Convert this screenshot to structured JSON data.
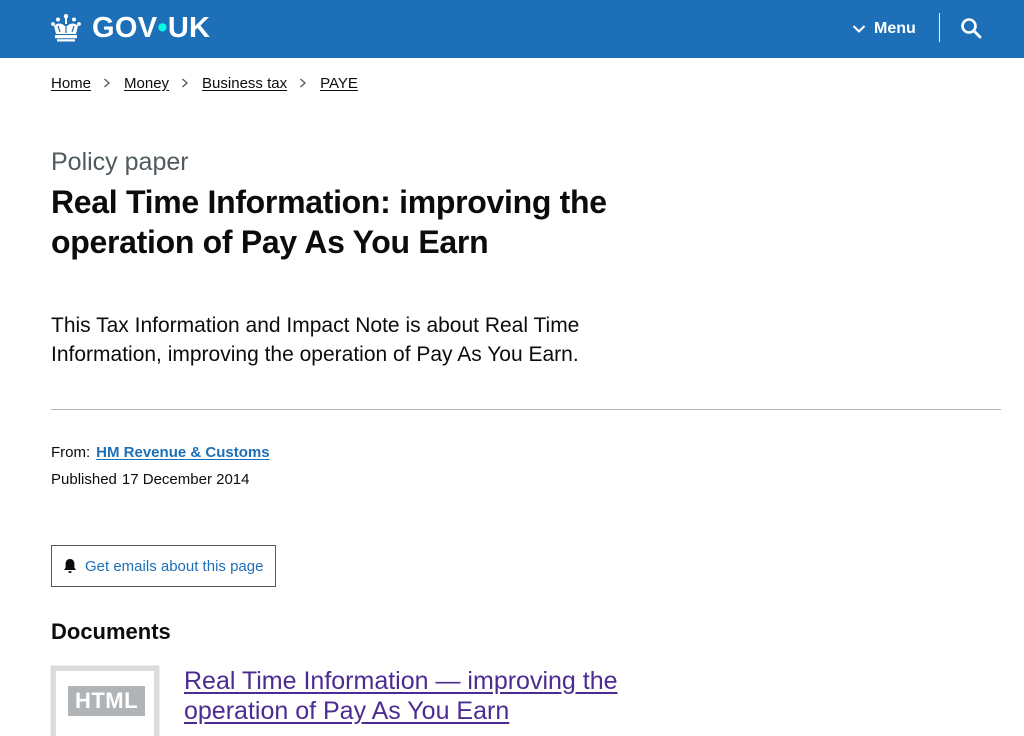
{
  "header": {
    "logo_text": "GOV",
    "logo_dot": "•",
    "logo_suffix": "UK",
    "menu_label": "Menu",
    "brand_color": "#1d70b8"
  },
  "breadcrumbs": [
    {
      "label": "Home"
    },
    {
      "label": "Money"
    },
    {
      "label": "Business tax"
    },
    {
      "label": "PAYE"
    }
  ],
  "page": {
    "doc_type": "Policy paper",
    "title": "Real Time Information: improving the operation of Pay As You Earn",
    "summary": "This Tax Information and Impact Note is about Real Time Information, improving the operation of Pay As You Earn."
  },
  "metadata": {
    "from_label": "From:",
    "from_org": "HM Revenue & Customs",
    "published_label": "Published",
    "published_date": "17 December 2014"
  },
  "email_signup": {
    "label": "Get emails about this page",
    "icon": "bell-icon"
  },
  "documents": {
    "heading": "Documents",
    "items": [
      {
        "format_badge": "HTML",
        "title": "Real Time Information — improving the operation of Pay As You Earn"
      }
    ]
  },
  "colors": {
    "link": "#1d70b8",
    "visited_link": "#4c2c92",
    "text": "#0b0c0c",
    "secondary_text": "#505a5f",
    "border": "#b1b4b6"
  }
}
